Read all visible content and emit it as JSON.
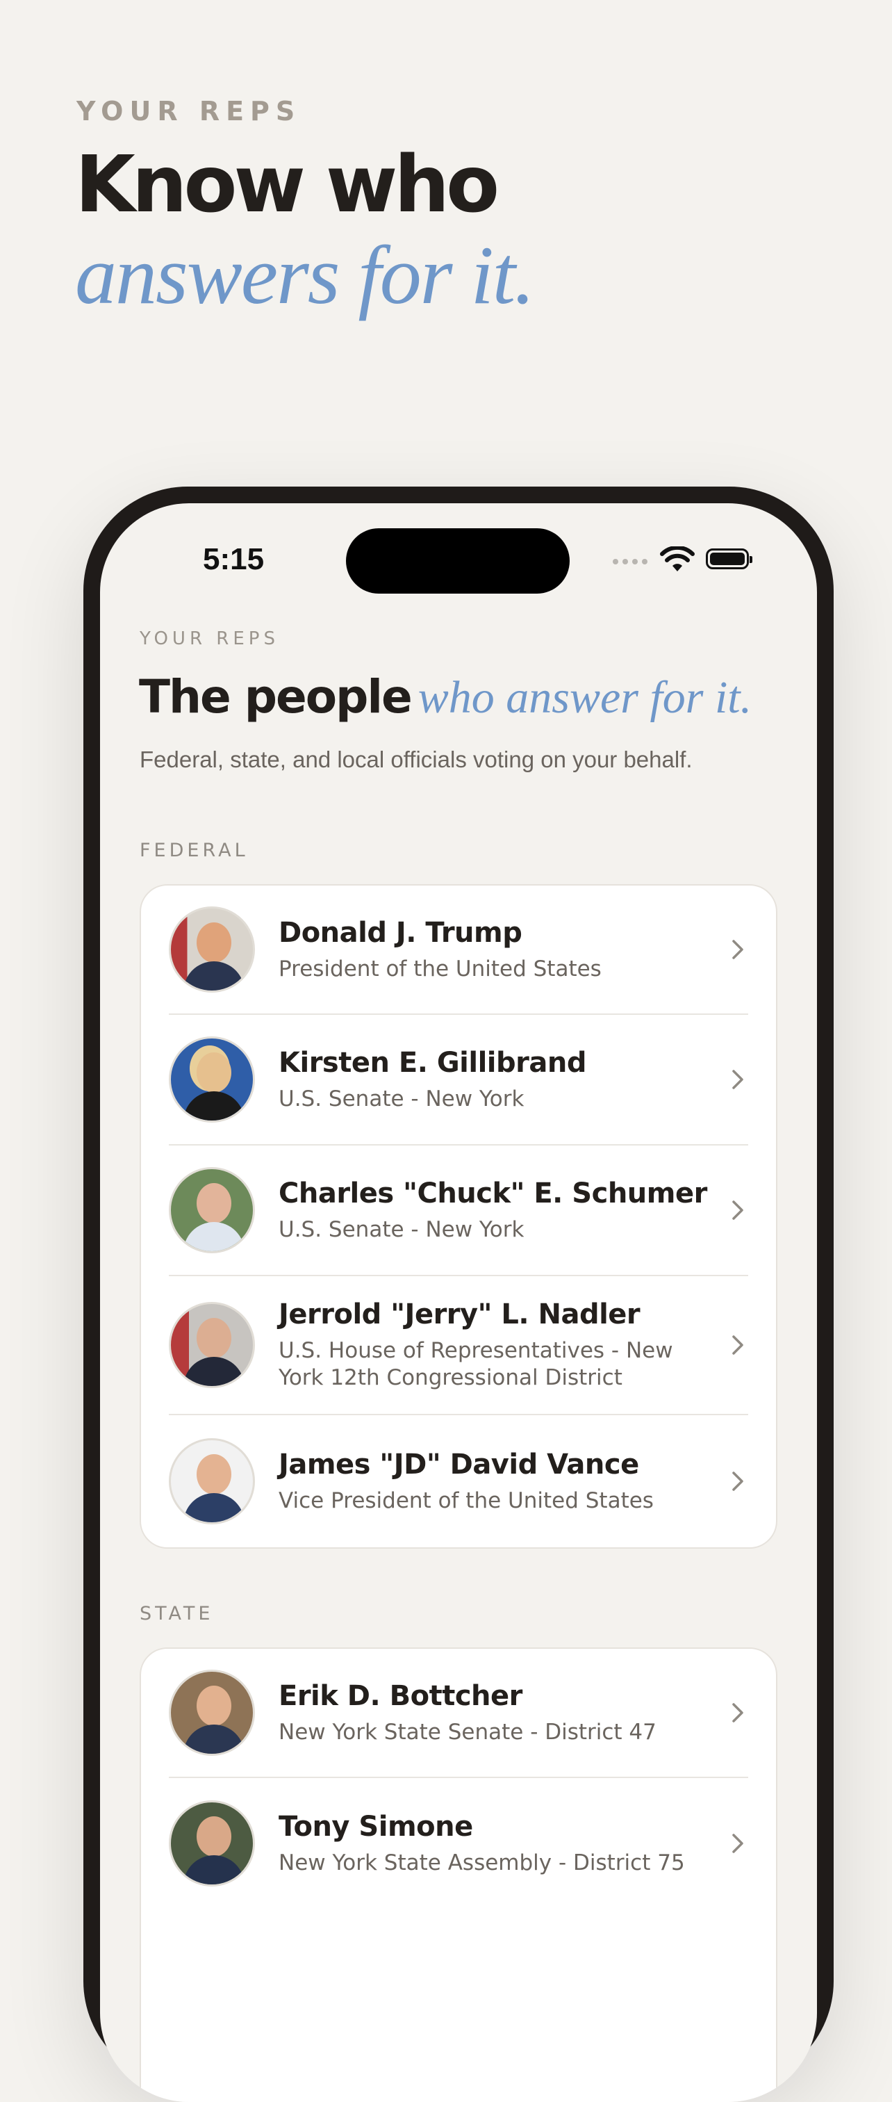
{
  "hero": {
    "eyebrow": "YOUR REPS",
    "line1": "Know who",
    "line2": "answers for it."
  },
  "status_bar": {
    "time": "5:15"
  },
  "screen": {
    "eyebrow": "YOUR REPS",
    "title_bold": "The people",
    "title_italic": "who answer for it.",
    "subtitle": "Federal, state, and local officials voting on your behalf."
  },
  "sections": {
    "federal": {
      "label": "FEDERAL",
      "reps": [
        {
          "name": "Donald J. Trump",
          "role": "President of the United States"
        },
        {
          "name": "Kirsten E. Gillibrand",
          "role": "U.S. Senate - New York"
        },
        {
          "name": "Charles \"Chuck\" E. Schumer",
          "role": "U.S. Senate - New York"
        },
        {
          "name": "Jerrold \"Jerry\" L. Nadler",
          "role": "U.S. House of Representatives - New York 12th Congressional District"
        },
        {
          "name": "James \"JD\" David Vance",
          "role": "Vice President of the United States"
        }
      ]
    },
    "state": {
      "label": "STATE",
      "reps": [
        {
          "name": "Erik D. Bottcher",
          "role": "New York State Senate - District 47"
        },
        {
          "name": "Tony Simone",
          "role": "New York State Assembly - District 75"
        }
      ]
    }
  },
  "colors": {
    "background": "#f4f2ee",
    "accent_blue": "#6f97c9",
    "text_dark": "#231f1c",
    "text_muted": "#6a645e"
  },
  "icons": [
    "wifi-icon",
    "battery-icon",
    "chevron-right-icon"
  ]
}
